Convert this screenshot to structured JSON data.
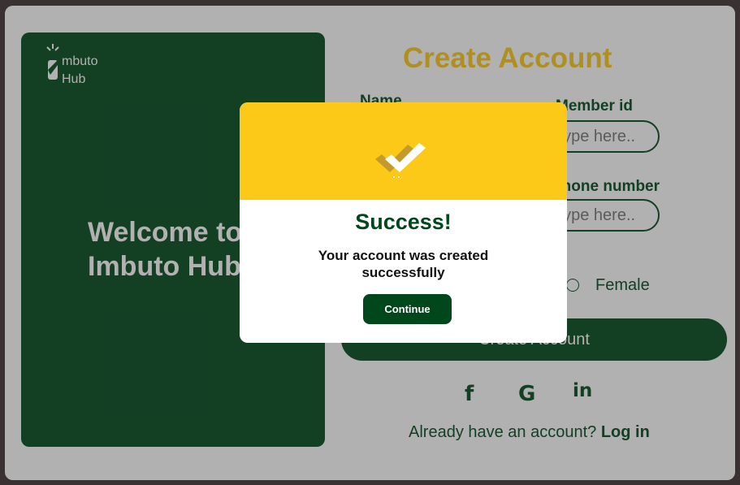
{
  "brand": {
    "logo_line1": "mbuto",
    "logo_line2": "Hub"
  },
  "welcome": {
    "line1": "Welcome to",
    "line2": "Imbuto Hub"
  },
  "form": {
    "title": "Create Account",
    "name_label": "Name",
    "member_id_label": "Member id",
    "member_id_placeholder": "Type here..",
    "phone_label": "Phone number",
    "phone_placeholder": "Type here..",
    "gender_female": "Female",
    "submit_label": "Create Account"
  },
  "social": {
    "facebook": "f",
    "google": "G",
    "linkedin": "in"
  },
  "login": {
    "prompt": "Already have an account?",
    "link": "Log in"
  },
  "modal": {
    "title": "Success!",
    "message": "Your account was created successfully",
    "button": "Continue"
  },
  "colors": {
    "primary_green": "#00471b",
    "accent_yellow": "#fdc918",
    "check_gold": "#c39a2b"
  },
  "icons": [
    "logo-icon",
    "double-check-icon",
    "facebook-icon",
    "google-icon",
    "linkedin-icon"
  ]
}
